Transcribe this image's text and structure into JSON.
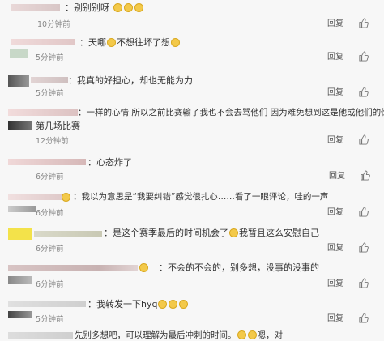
{
  "comments": [
    {
      "text": "：别别别呀",
      "emoji_count": 3,
      "time": "10分钟前",
      "actions": [
        "回复",
        "赞"
      ]
    },
    {
      "text": "：天哪",
      "text2": "不想往坏了想",
      "time": "5分钟前",
      "actions": [
        "回复",
        "赞"
      ]
    },
    {
      "text": "：我真的好担心，却也无能为力",
      "time": "5分钟前",
      "actions": [
        "回复",
        "赞"
      ]
    },
    {
      "text": "：一样的心情 所以之前比赛输了我也不会去骂他们 因为难免想到这是他或他们的倒数",
      "text2": "第几场比赛",
      "time": "12分钟前",
      "actions": [
        "回复",
        "赞"
      ]
    },
    {
      "text": "：心态炸了",
      "time": "6分钟前",
      "actions": [
        "回复",
        "赞"
      ]
    },
    {
      "text": "：我以为意思是“我要纠错”感觉很扎心……看了一眼评论，哇的一声",
      "time": "6分钟前",
      "actions": [
        "回复",
        "赞"
      ]
    },
    {
      "text": "：是这个赛季最后的时间机会了",
      "text2": "我暂且这么安慰自己",
      "time": "6分钟前",
      "actions": [
        "回复",
        "赞"
      ]
    },
    {
      "text": "：不会的不会的，别多想，没事的没事的",
      "time": "6分钟前",
      "actions": [
        "回复",
        "赞"
      ]
    },
    {
      "text": "：我转发一下hyq",
      "emoji_count": 3,
      "time": "5分钟前",
      "actions": [
        "回复",
        "赞"
      ]
    },
    {
      "text": "先别多想吧，可以理解为最后冲刺的时间。",
      "text2": "嗯，对",
      "time": "",
      "actions": []
    }
  ],
  "icons": {
    "like": "thumbs-up-icon",
    "emoji": "emoji-face-icon"
  }
}
